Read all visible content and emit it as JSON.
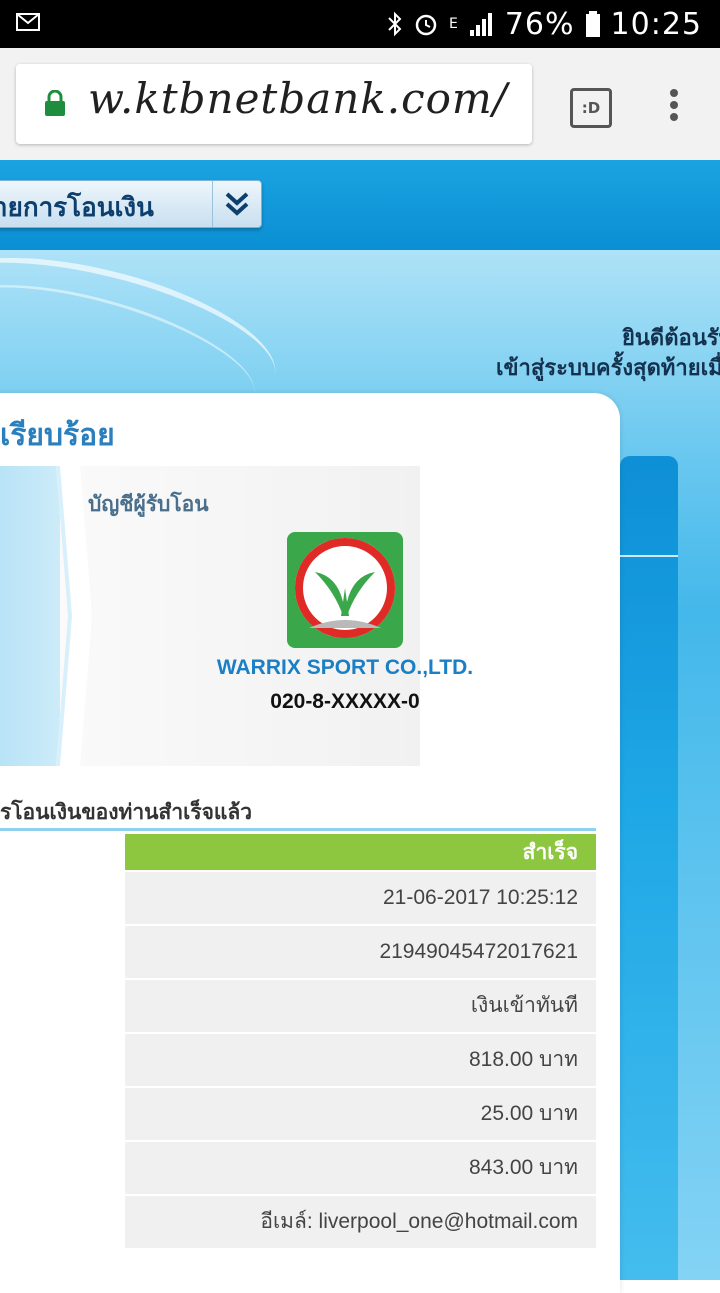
{
  "status_bar": {
    "battery_percent": "76%",
    "time": "10:25",
    "network": "E"
  },
  "browser": {
    "url": "w.ktbnetbank.com/",
    "tabs_label": ":D"
  },
  "nav": {
    "dropdown_label": "ายการโอนเงิน"
  },
  "welcome": {
    "line1": "ยินดีต้อนรับ",
    "line2": "เข้าสู่ระบบครั้งสุดท้ายเมื่อ"
  },
  "transfer": {
    "title": "เรียบร้อย",
    "recipient_label": "บัญชีผู้รับโอน",
    "payee_name": "WARRIX SPORT CO.,LTD.",
    "payee_account": "020-8-XXXXX-0",
    "status_line": "รโอนเงินของท่านสำเร็จแล้ว",
    "status_badge": "สำเร็จ",
    "rows": [
      "21-06-2017 10:25:12",
      "21949045472017621",
      "เงินเข้าทันที",
      "818.00 บาท",
      "25.00 บาท",
      "843.00 บาท",
      "อีเมล์: liverpool_one@hotmail.com"
    ]
  },
  "colors": {
    "brand_blue": "#0b8fd4",
    "success_green": "#8dc63f",
    "kbank_green": "#3aa84a"
  }
}
